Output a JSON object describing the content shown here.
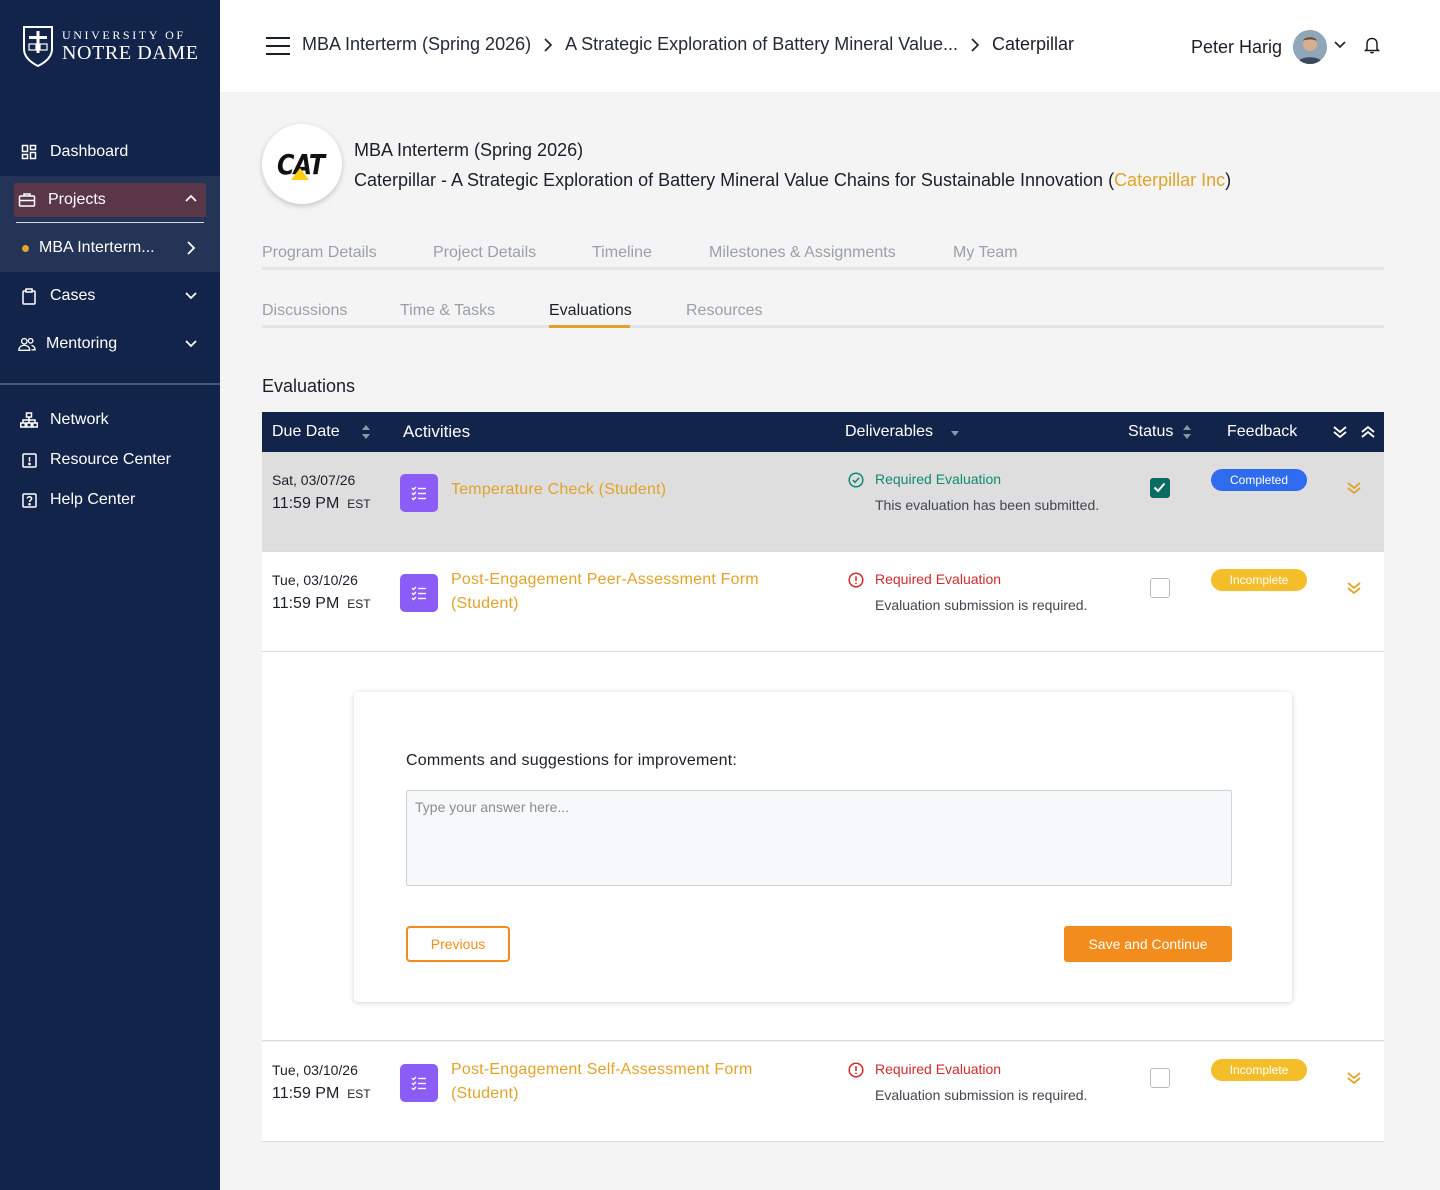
{
  "sidebar": {
    "logo": {
      "line1": "UNIVERSITY OF",
      "line2": "NOTRE DAME"
    },
    "items": [
      {
        "label": "Dashboard",
        "icon": "dashboard-icon"
      },
      {
        "label": "Projects",
        "icon": "briefcase-icon"
      },
      {
        "label": "Cases",
        "icon": "clipboard-icon"
      },
      {
        "label": "Mentoring",
        "icon": "users-icon"
      },
      {
        "label": "Network",
        "icon": "network-icon"
      },
      {
        "label": "Resource Center",
        "icon": "alert-box-icon"
      },
      {
        "label": "Help Center",
        "icon": "help-box-icon"
      }
    ],
    "sub_item": "MBA Interterm..."
  },
  "header": {
    "breadcrumbs": [
      "MBA Interterm (Spring 2026)",
      "A Strategic Exploration of Battery Mineral Value...",
      "Caterpillar"
    ],
    "user_name": "Peter Harig"
  },
  "project": {
    "logo_text": "CAT",
    "program": "MBA Interterm (Spring 2026)",
    "title": "Caterpillar - A Strategic Exploration of Battery Mineral Value Chains for Sustainable Innovation (",
    "company": "Caterpillar Inc",
    "close_paren": ")"
  },
  "tabs_primary": [
    "Program Details",
    "Project Details",
    "Timeline",
    "Milestones & Assignments",
    "My Team"
  ],
  "tabs_secondary": [
    "Discussions",
    "Time & Tasks",
    "Evaluations",
    "Resources"
  ],
  "active_tab": "Evaluations",
  "section_title": "Evaluations",
  "table": {
    "headers": {
      "due_date": "Due Date",
      "activities": "Activities",
      "deliverables": "Deliverables",
      "status": "Status",
      "feedback": "Feedback"
    },
    "rows": [
      {
        "date": "Sat, 03/07/26",
        "time": "11:59 PM",
        "tz": "EST",
        "activity": "Temperature Check (Student)",
        "deliverable_title": "Required Evaluation",
        "deliverable_sub": "This evaluation has been submitted.",
        "checked": true,
        "badge": "Completed"
      },
      {
        "date": "Tue, 03/10/26",
        "time": "11:59 PM",
        "tz": "EST",
        "activity": "Post-Engagement Peer-Assessment Form (Student)",
        "deliverable_title": "Required Evaluation",
        "deliverable_sub": "Evaluation submission is required.",
        "checked": false,
        "badge": "Incomplete"
      },
      {
        "date": "Tue, 03/10/26",
        "time": "11:59 PM",
        "tz": "EST",
        "activity": "Post-Engagement Self-Assessment Form (Student)",
        "deliverable_title": "Required Evaluation",
        "deliverable_sub": "Evaluation submission is required.",
        "checked": false,
        "badge": "Incomplete"
      }
    ]
  },
  "form": {
    "label": "Comments and suggestions for improvement:",
    "placeholder": "Type your answer here...",
    "value": "",
    "previous_label": "Previous",
    "save_label": "Save and Continue"
  },
  "colors": {
    "sidebar_bg": "#13244a",
    "accent": "#e1a32b",
    "primary_button": "#f28c1c",
    "completed_badge": "#2f6bef",
    "incomplete_badge": "#f4bd2a",
    "success": "#0f8a6f",
    "error": "#d12b2b"
  }
}
